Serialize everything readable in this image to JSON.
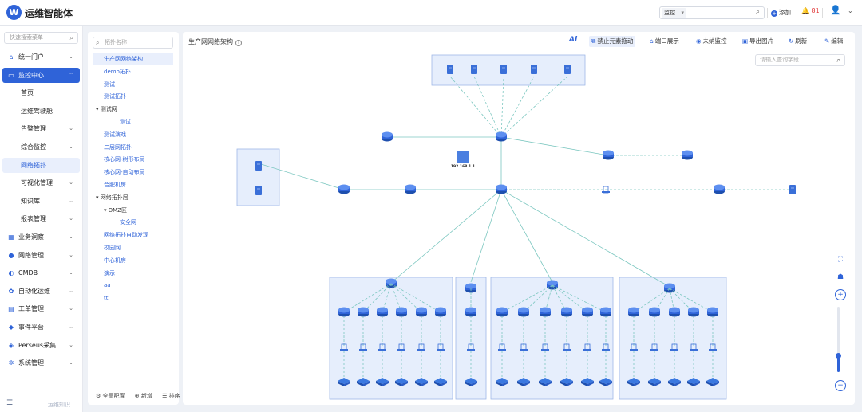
{
  "app": {
    "title": "运维智能体",
    "logo_letter": "W"
  },
  "header": {
    "search_select": "监控",
    "add_label": "添加",
    "alert_count": "81"
  },
  "sidebar": {
    "search_placeholder": "快速搜索菜单",
    "items": [
      {
        "label": "统一门户",
        "icon": "home-icon",
        "level": 0
      },
      {
        "label": "监控中心",
        "icon": "monitor-icon",
        "level": 0,
        "active": true
      },
      {
        "label": "首页",
        "level": 1
      },
      {
        "label": "运维驾驶舱",
        "level": 1
      },
      {
        "label": "告警管理",
        "level": 1,
        "caret": true
      },
      {
        "label": "综合监控",
        "level": 1,
        "caret": true
      },
      {
        "label": "网络拓扑",
        "level": 1,
        "selected": true
      },
      {
        "label": "可视化管理",
        "level": 1,
        "caret": true
      },
      {
        "label": "知识库",
        "level": 1,
        "caret": true
      },
      {
        "label": "报表管理",
        "level": 1,
        "caret": true
      },
      {
        "label": "业务洞察",
        "icon": "insight-icon",
        "level": 0
      },
      {
        "label": "网络管理",
        "icon": "network-icon",
        "level": 0
      },
      {
        "label": "CMDB",
        "icon": "cmdb-icon",
        "level": 0
      },
      {
        "label": "自动化运维",
        "icon": "automation-icon",
        "level": 0
      },
      {
        "label": "工单管理",
        "icon": "ticket-icon",
        "level": 0
      },
      {
        "label": "事件平台",
        "icon": "event-icon",
        "level": 0
      },
      {
        "label": "Perseus采集",
        "icon": "collect-icon",
        "level": 0
      },
      {
        "label": "系统管理",
        "icon": "settings-icon",
        "level": 0
      }
    ],
    "footer": "运维知识"
  },
  "tree": {
    "search_placeholder": "拓扑名称",
    "items": [
      {
        "label": "生产网网络架构",
        "indent": 0,
        "selected": true
      },
      {
        "label": "demo拓扑",
        "indent": 0
      },
      {
        "label": "测试",
        "indent": 0
      },
      {
        "label": "测试拓扑",
        "indent": 0
      },
      {
        "label": "测试网",
        "indent": 0,
        "expand": true
      },
      {
        "label": "测试",
        "indent": 2
      },
      {
        "label": "测试演戏",
        "indent": 0
      },
      {
        "label": "二层网拓扑",
        "indent": 0
      },
      {
        "label": "核心网-树形布局",
        "indent": 0
      },
      {
        "label": "核心网-自动布局",
        "indent": 0
      },
      {
        "label": "合肥机房",
        "indent": 0
      },
      {
        "label": "网络拓扑层",
        "indent": 0,
        "expand": true
      },
      {
        "label": "DMZ区",
        "indent": 1,
        "expand": true
      },
      {
        "label": "安全网",
        "indent": 2
      },
      {
        "label": "网络拓扑自动发现",
        "indent": 0
      },
      {
        "label": "校园网",
        "indent": 0
      },
      {
        "label": "中心机房",
        "indent": 0
      },
      {
        "label": "演示",
        "indent": 0
      },
      {
        "label": "aa",
        "indent": 0
      },
      {
        "label": "tt",
        "indent": 0
      }
    ],
    "footer": {
      "global_config": "全局配置",
      "add": "新增",
      "sort": "排序"
    }
  },
  "main": {
    "title": "生产网网络架构",
    "toolbar": {
      "ai": "Ai",
      "disable_drag": "禁止元素拖动",
      "port_display": "端口展示",
      "unmonitored": "未纳监控",
      "export_image": "导出图片",
      "refresh": "刷新",
      "edit": "编辑"
    },
    "field_search_placeholder": "请输入查询字段",
    "center_label": "192.168.1.1",
    "zoom_level": 0.25
  },
  "colors": {
    "accent": "#2f63d8",
    "group_fill": "#e6eefc",
    "group_stroke": "#9fb7e6",
    "link": "#7cc7c0",
    "alert": "#e23a3a"
  }
}
